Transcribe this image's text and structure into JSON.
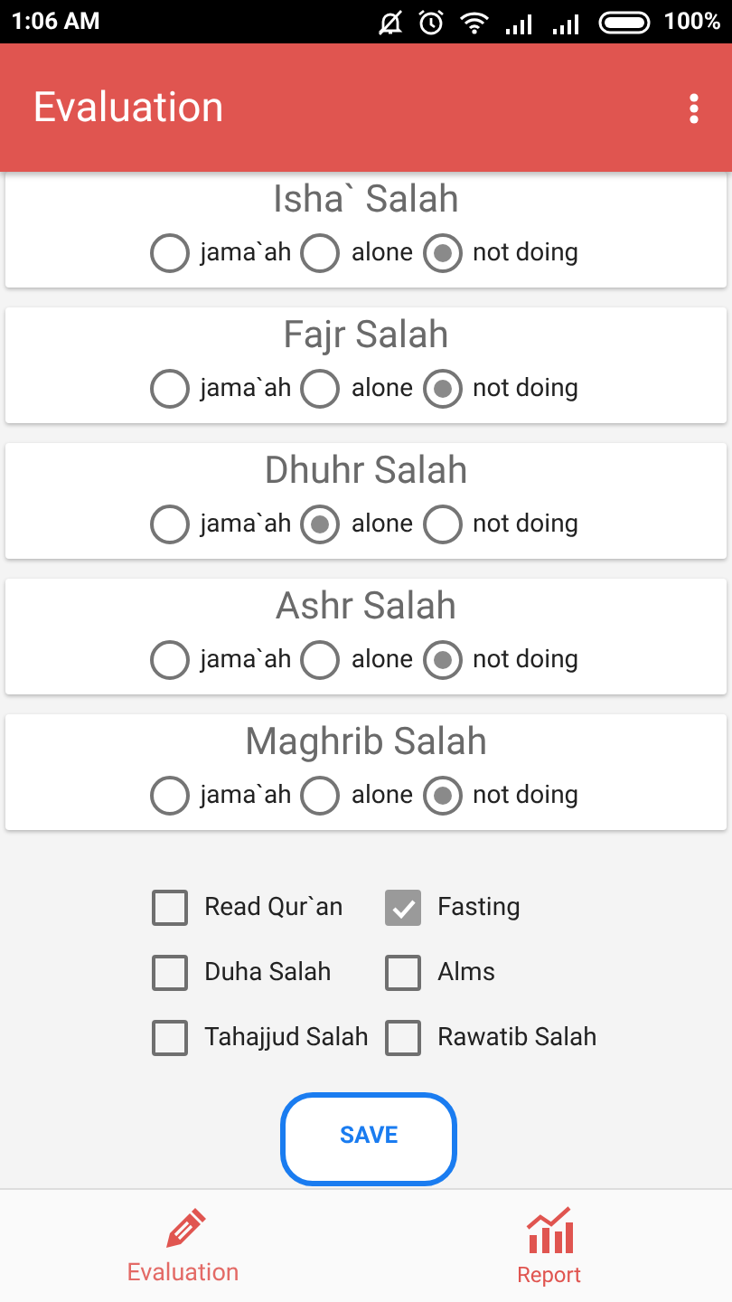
{
  "status_bar": {
    "time": "1:06 AM",
    "battery": "100%"
  },
  "toolbar": {
    "title": "Evaluation"
  },
  "prayers": [
    {
      "name": "Isha` Salah",
      "options": [
        {
          "label": "jama`ah",
          "selected": false
        },
        {
          "label": "alone",
          "selected": false
        },
        {
          "label": "not doing",
          "selected": true
        }
      ]
    },
    {
      "name": "Fajr Salah",
      "options": [
        {
          "label": "jama`ah",
          "selected": false
        },
        {
          "label": "alone",
          "selected": false
        },
        {
          "label": "not doing",
          "selected": true
        }
      ]
    },
    {
      "name": "Dhuhr Salah",
      "options": [
        {
          "label": "jama`ah",
          "selected": false
        },
        {
          "label": "alone",
          "selected": true
        },
        {
          "label": "not doing",
          "selected": false
        }
      ]
    },
    {
      "name": "Ashr Salah",
      "options": [
        {
          "label": "jama`ah",
          "selected": false
        },
        {
          "label": "alone",
          "selected": false
        },
        {
          "label": "not doing",
          "selected": true
        }
      ]
    },
    {
      "name": "Maghrib Salah",
      "options": [
        {
          "label": "jama`ah",
          "selected": false
        },
        {
          "label": "alone",
          "selected": false
        },
        {
          "label": "not doing",
          "selected": true
        }
      ]
    }
  ],
  "deeds": [
    {
      "label": "Read Qur`an",
      "checked": false
    },
    {
      "label": "Fasting",
      "checked": true
    },
    {
      "label": "Duha Salah",
      "checked": false
    },
    {
      "label": "Alms",
      "checked": false
    },
    {
      "label": "Tahajjud Salah",
      "checked": false
    },
    {
      "label": "Rawatib Salah",
      "checked": false
    }
  ],
  "save_button": "SAVE",
  "bottom_nav": [
    {
      "label": "Evaluation",
      "selected": true
    },
    {
      "label": "Report",
      "selected": false
    }
  ]
}
